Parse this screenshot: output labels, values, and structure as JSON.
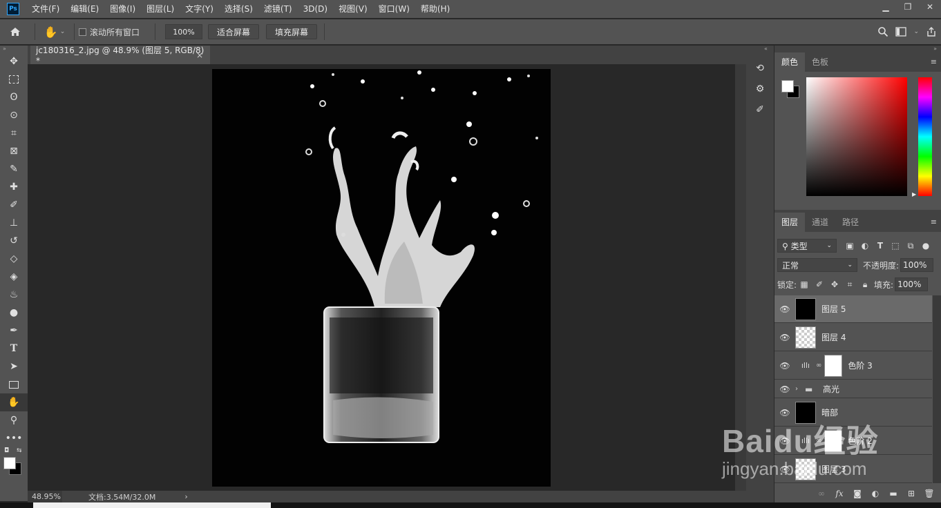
{
  "app": {
    "logo": "Ps"
  },
  "menu": [
    "文件(F)",
    "编辑(E)",
    "图像(I)",
    "图层(L)",
    "文字(Y)",
    "选择(S)",
    "滤镜(T)",
    "3D(D)",
    "视图(V)",
    "窗口(W)",
    "帮助(H)"
  ],
  "options": {
    "scroll_all_label": "滚动所有窗口",
    "zoom_value": "100%",
    "fit_screen": "适合屏幕",
    "fill_screen": "填充屏幕"
  },
  "document": {
    "tab_title": "jc180316_2.jpg @ 48.9% (图层 5, RGB/8) *",
    "close": "×"
  },
  "status": {
    "zoom": "48.95%",
    "doc_info": "文档:3.54M/32.0M",
    "arrow": "›"
  },
  "color_panel": {
    "tabs": [
      "颜色",
      "色板"
    ],
    "accent_hue": "#ff0000"
  },
  "layers_panel": {
    "tabs": [
      "图层",
      "通道",
      "路径"
    ],
    "filter_label": "类型",
    "blend_mode": "正常",
    "opacity_label": "不透明度:",
    "opacity_value": "100%",
    "lock_label": "锁定:",
    "fill_label": "填充:",
    "fill_value": "100%",
    "layers": [
      {
        "name": "图层 5",
        "selected": true
      },
      {
        "name": "图层 4",
        "selected": false
      },
      {
        "name": "色阶 3",
        "selected": false
      },
      {
        "name": "高光",
        "selected": false
      },
      {
        "name": "暗部",
        "selected": false
      },
      {
        "name": "色阶 2",
        "selected": false
      },
      {
        "name": "图层 3",
        "selected": false
      }
    ]
  },
  "watermark": {
    "brand": "Baidu经验",
    "url": "jingyan.baidu.com"
  }
}
